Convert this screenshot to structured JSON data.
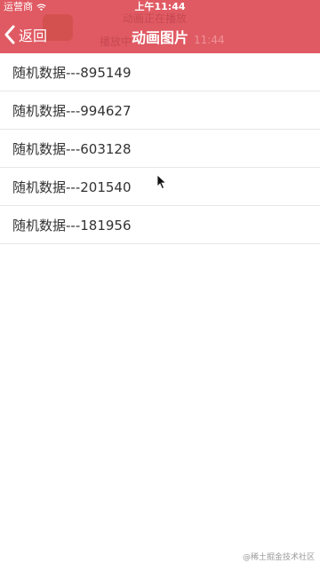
{
  "status_bar": {
    "carrier": "运营商",
    "time": "上午11:44"
  },
  "ghost": {
    "line1": "动画正在播放",
    "line2": "播放中",
    "line3": "11:44"
  },
  "nav": {
    "back_label": "返回",
    "title": "动画图片"
  },
  "list": {
    "items": [
      "随机数据---895149",
      "随机数据---994627",
      "随机数据---603128",
      "随机数据---201540",
      "随机数据---181956"
    ]
  },
  "watermark": "@稀土掘金技术社区",
  "colors": {
    "header": "#e05a63",
    "text": "#333333",
    "divider": "#e7e7e7"
  }
}
